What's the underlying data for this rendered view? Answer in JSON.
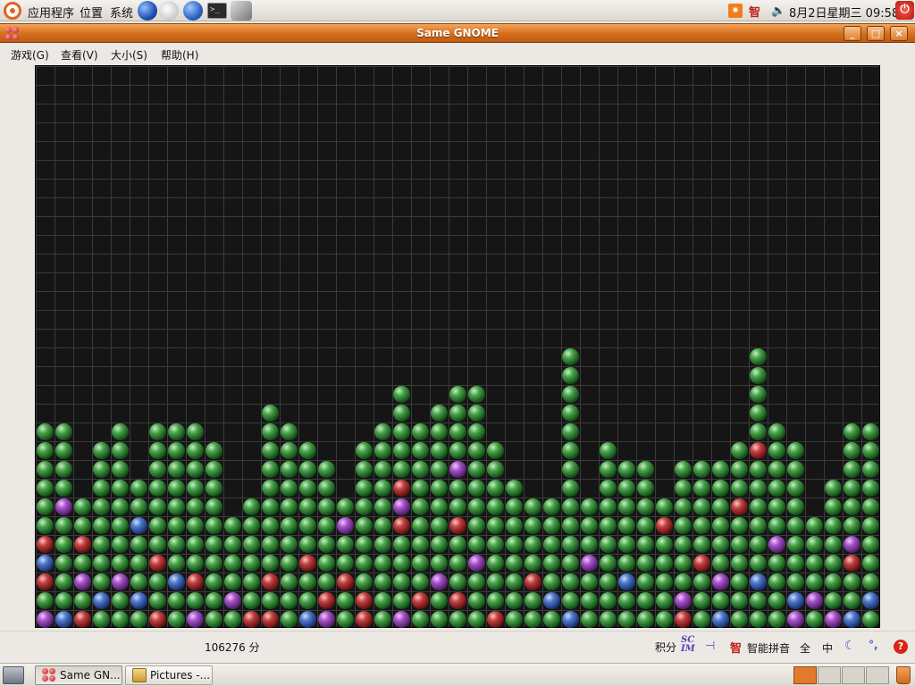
{
  "top_panel": {
    "menus": [
      "应用程序",
      "位置",
      "系统"
    ],
    "launchers": [
      "firefox-globe-icon",
      "mail-icon",
      "network-icon",
      "terminal-icon",
      "wing-icon"
    ],
    "tray": {
      "update_icon": "sun-icon",
      "ime_icon": "智",
      "volume_icon": "speaker-icon",
      "clock": "8月2日星期三 09:58",
      "power_icon": "power-icon"
    }
  },
  "window": {
    "title": "Same GNOME",
    "buttons": {
      "minimize": "_",
      "maximize": "□",
      "close": "×"
    }
  },
  "menubar": {
    "items": [
      "游戏(G)",
      "查看(V)",
      "大小(S)",
      "帮助(H)"
    ]
  },
  "game": {
    "columns": 45,
    "rows": 30,
    "colors": {
      "g": "#2e7d32",
      "r": "#b71c1c",
      "b": "#3357a8",
      "p": "#8e3fb0"
    },
    "board": [
      ".............................................",
      ".............................................",
      ".............................................",
      ".............................................",
      ".............................................",
      ".............................................",
      ".............................................",
      ".............................................",
      ".............................................",
      ".............................................",
      ".............................................",
      ".............................................",
      ".............................................",
      ".............................................",
      ".............................................",
      ".............................................",
      ".............................................",
      ".............................................",
      ".............................................",
      ".............................................",
      ".............................................",
      ".............................................",
      ".............................................",
      ".............................................",
      ".............................................",
      ".............................................",
      ".............................................",
      ".............................................",
      ".............................................",
      "............................................."
    ]
  },
  "statusbar": {
    "score": "106276 分",
    "score_label": "积分",
    "ime_indicator": "智",
    "ime_name": "智能拼音",
    "ime_full": "全",
    "ime_mid": "中",
    "punct": "°,"
  },
  "bottom_panel": {
    "tasks": [
      {
        "label": "Same GN...",
        "icon": "same-gnome-icon",
        "active": true
      },
      {
        "label": "Pictures -...",
        "icon": "folder-icon",
        "active": false
      }
    ],
    "workspaces": 4
  }
}
